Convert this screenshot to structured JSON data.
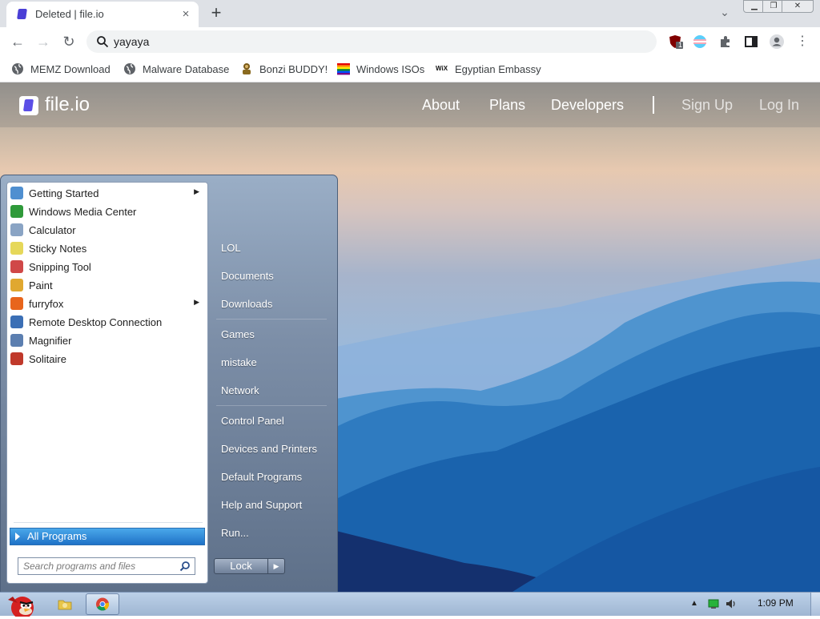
{
  "browser": {
    "tab": {
      "title": "Deleted | file.io",
      "close_icon": "×"
    },
    "new_tab_icon": "+",
    "tab_menu_icon": "⌄",
    "window_buttons": {
      "minimize": "▁",
      "maximize": "❐",
      "close": "✕"
    },
    "nav": {
      "back": "←",
      "forward": "→",
      "reload": "↻"
    },
    "omnibox": {
      "value": "yayaya"
    },
    "extension_badge": "1",
    "menu_icon": "⋮"
  },
  "bookmarks": [
    {
      "label": "MEMZ Download",
      "icon": "globe-icon"
    },
    {
      "label": "Malware Database",
      "icon": "globe-icon"
    },
    {
      "label": "Bonzi BUDDY!",
      "icon": "bonzi-icon"
    },
    {
      "label": "Windows ISOs",
      "icon": "rainbow-flag-icon"
    },
    {
      "label": "Egyptian Embassy",
      "icon": "wix-icon",
      "icon_text": "WiX"
    }
  ],
  "site": {
    "logo": "file.io",
    "nav": {
      "about": "About",
      "plans": "Plans",
      "developers": "Developers",
      "signup": "Sign Up",
      "login": "Log In"
    }
  },
  "start_menu": {
    "programs": [
      {
        "label": "Getting Started",
        "has_submenu": true,
        "color": "#4f8fd0"
      },
      {
        "label": "Windows Media Center",
        "has_submenu": false,
        "color": "#2f9a3a"
      },
      {
        "label": "Calculator",
        "has_submenu": false,
        "color": "#8aa4c4"
      },
      {
        "label": "Sticky Notes",
        "has_submenu": false,
        "color": "#e6d85a"
      },
      {
        "label": "Snipping Tool",
        "has_submenu": false,
        "color": "#d04848"
      },
      {
        "label": "Paint",
        "has_submenu": false,
        "color": "#e0a830"
      },
      {
        "label": "furryfox",
        "has_submenu": true,
        "color": "#e8651c"
      },
      {
        "label": "Remote Desktop Connection",
        "has_submenu": false,
        "color": "#3b6fb5"
      },
      {
        "label": "Magnifier",
        "has_submenu": false,
        "color": "#5c7fb0"
      },
      {
        "label": "Solitaire",
        "has_submenu": false,
        "color": "#c0392b"
      }
    ],
    "submenu_arrow": "▶",
    "all_programs": "All Programs",
    "search_placeholder": "Search programs and files",
    "right_items": [
      "LOL",
      "Documents",
      "Downloads",
      "Games",
      "mistake",
      "Network",
      "Control Panel",
      "Devices and Printers",
      "Default Programs",
      "Help and Support",
      "Run..."
    ],
    "lock": "Lock",
    "lock_arrow": "▶"
  },
  "taskbar": {
    "tray_arrow": "▲",
    "clock": "1:09 PM"
  },
  "colors": {
    "accent": "#5b4ee6",
    "taskbar": "#bcd0e8",
    "start_menu": "#7c8ea7"
  }
}
